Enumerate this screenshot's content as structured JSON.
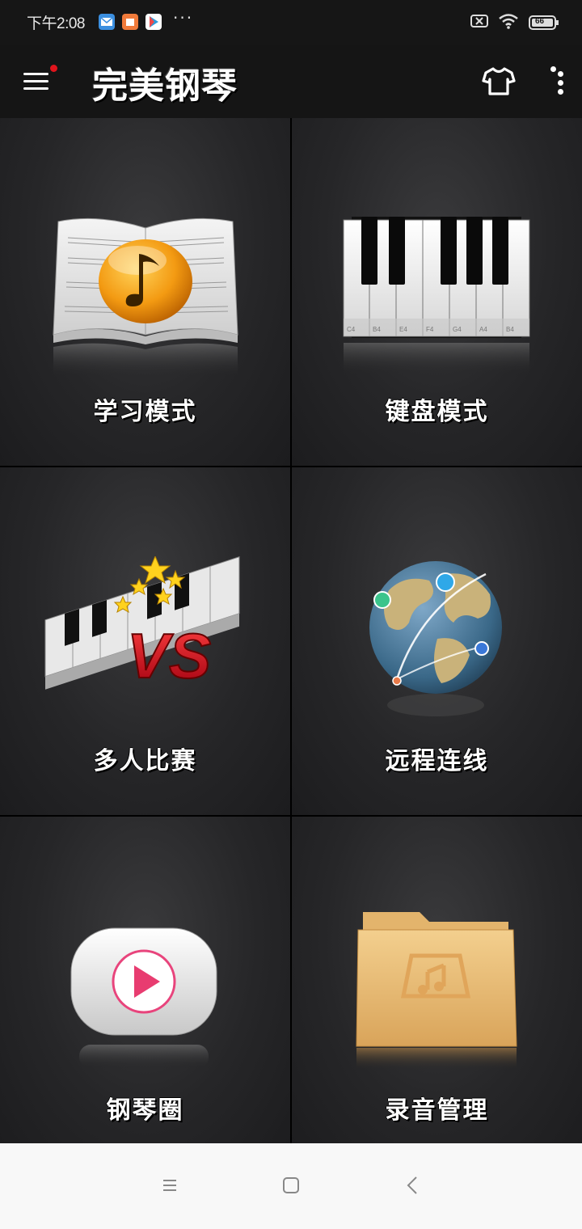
{
  "status": {
    "time": "下午2:08",
    "dots": "···",
    "battery": "66"
  },
  "app": {
    "title": "完美钢琴"
  },
  "tiles": [
    {
      "label": "学习模式"
    },
    {
      "label": "键盘模式"
    },
    {
      "label": "多人比赛"
    },
    {
      "label": "远程连线"
    },
    {
      "label": "钢琴圈"
    },
    {
      "label": "录音管理"
    }
  ],
  "keyboard": {
    "key_labels": [
      "C4",
      "B4",
      "E4",
      "F4",
      "G4",
      "A4",
      "B4"
    ]
  },
  "vs_text": "VS",
  "colors": {
    "accent_red": "#e0141c",
    "tile_bg": "#2a2a2c",
    "nav_bg": "#f8f8f8"
  },
  "icons": [
    "menu-icon",
    "tshirt-icon",
    "more-vert-icon",
    "music-book-icon",
    "piano-keys-icon",
    "vs-battle-icon",
    "globe-network-icon",
    "play-video-icon",
    "music-folder-icon"
  ]
}
